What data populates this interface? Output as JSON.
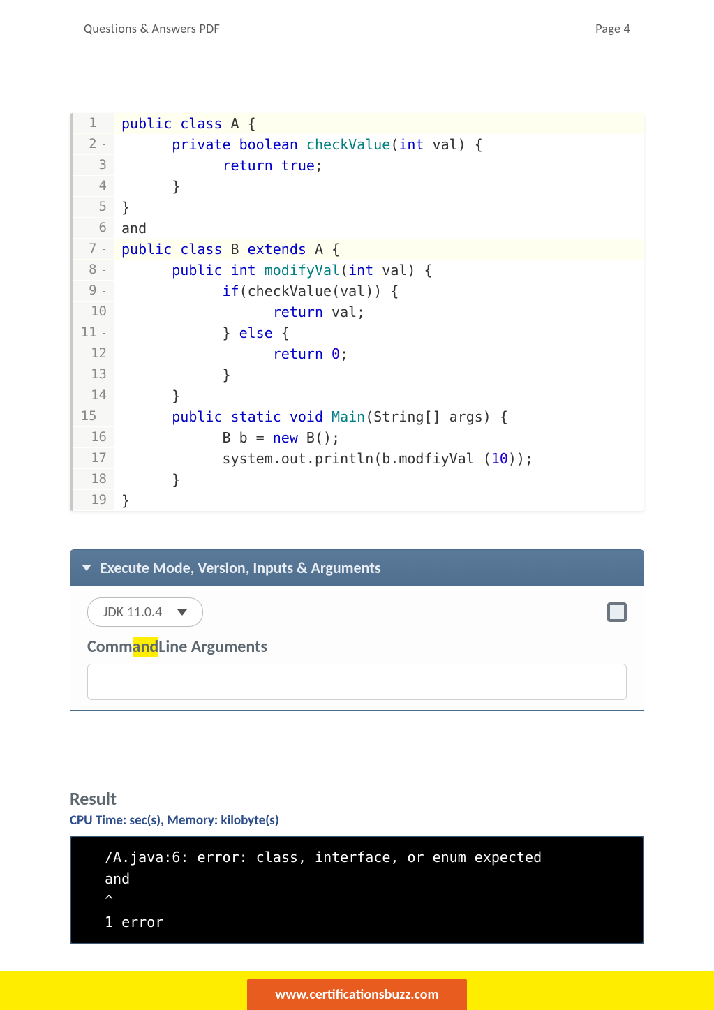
{
  "header": {
    "left": "Questions & Answers PDF",
    "right": "Page 4"
  },
  "code": {
    "lines": [
      {
        "n": "1",
        "fold": true,
        "hl": true,
        "tokens": [
          {
            "t": "public class ",
            "c": "kw"
          },
          {
            "t": "A {",
            "c": "plain"
          }
        ]
      },
      {
        "n": "2",
        "fold": true,
        "hl": false,
        "tokens": [
          {
            "t": "      ",
            "c": "plain"
          },
          {
            "t": "private boolean ",
            "c": "kw"
          },
          {
            "t": "checkValue",
            "c": "fn"
          },
          {
            "t": "(",
            "c": "plain"
          },
          {
            "t": "int ",
            "c": "kw"
          },
          {
            "t": "val) {",
            "c": "plain"
          }
        ]
      },
      {
        "n": "3",
        "fold": false,
        "hl": false,
        "tokens": [
          {
            "t": "            ",
            "c": "plain"
          },
          {
            "t": "return true",
            "c": "kw"
          },
          {
            "t": ";",
            "c": "plain"
          }
        ]
      },
      {
        "n": "4",
        "fold": false,
        "hl": false,
        "tokens": [
          {
            "t": "      }",
            "c": "plain"
          }
        ]
      },
      {
        "n": "5",
        "fold": false,
        "hl": false,
        "tokens": [
          {
            "t": "}",
            "c": "plain"
          }
        ]
      },
      {
        "n": "6",
        "fold": false,
        "hl": false,
        "tokens": [
          {
            "t": "and",
            "c": "plain"
          }
        ]
      },
      {
        "n": "7",
        "fold": true,
        "hl": true,
        "tokens": [
          {
            "t": "public class ",
            "c": "kw"
          },
          {
            "t": "B ",
            "c": "plain"
          },
          {
            "t": "extends ",
            "c": "kw"
          },
          {
            "t": "A {",
            "c": "plain"
          }
        ]
      },
      {
        "n": "8",
        "fold": true,
        "hl": false,
        "tokens": [
          {
            "t": "      ",
            "c": "plain"
          },
          {
            "t": "public int ",
            "c": "kw"
          },
          {
            "t": "modifyVal",
            "c": "fn"
          },
          {
            "t": "(",
            "c": "plain"
          },
          {
            "t": "int ",
            "c": "kw"
          },
          {
            "t": "val) {",
            "c": "plain"
          }
        ]
      },
      {
        "n": "9",
        "fold": true,
        "hl": false,
        "tokens": [
          {
            "t": "            ",
            "c": "plain"
          },
          {
            "t": "if",
            "c": "kw"
          },
          {
            "t": "(checkValue(val)) {",
            "c": "plain"
          }
        ]
      },
      {
        "n": "10",
        "fold": false,
        "hl": false,
        "tokens": [
          {
            "t": "                  ",
            "c": "plain"
          },
          {
            "t": "return ",
            "c": "kw"
          },
          {
            "t": "val;",
            "c": "plain"
          }
        ]
      },
      {
        "n": "11",
        "fold": true,
        "hl": false,
        "tokens": [
          {
            "t": "            } ",
            "c": "plain"
          },
          {
            "t": "else ",
            "c": "kw"
          },
          {
            "t": "{",
            "c": "plain"
          }
        ]
      },
      {
        "n": "12",
        "fold": false,
        "hl": false,
        "tokens": [
          {
            "t": "                  ",
            "c": "plain"
          },
          {
            "t": "return ",
            "c": "kw"
          },
          {
            "t": "0",
            "c": "num"
          },
          {
            "t": ";",
            "c": "plain"
          }
        ]
      },
      {
        "n": "13",
        "fold": false,
        "hl": false,
        "tokens": [
          {
            "t": "            }",
            "c": "plain"
          }
        ]
      },
      {
        "n": "14",
        "fold": false,
        "hl": false,
        "tokens": [
          {
            "t": "      }",
            "c": "plain"
          }
        ]
      },
      {
        "n": "15",
        "fold": true,
        "hl": false,
        "tokens": [
          {
            "t": "      ",
            "c": "plain"
          },
          {
            "t": "public static void ",
            "c": "kw"
          },
          {
            "t": "Main",
            "c": "fn"
          },
          {
            "t": "(String[] args) {",
            "c": "plain"
          }
        ]
      },
      {
        "n": "16",
        "fold": false,
        "hl": false,
        "tokens": [
          {
            "t": "            B b = ",
            "c": "plain"
          },
          {
            "t": "new ",
            "c": "kw"
          },
          {
            "t": "B();",
            "c": "plain"
          }
        ]
      },
      {
        "n": "17",
        "fold": false,
        "hl": false,
        "tokens": [
          {
            "t": "            system.out.println(b.modfiyVal (",
            "c": "plain"
          },
          {
            "t": "10",
            "c": "num"
          },
          {
            "t": "));",
            "c": "plain"
          }
        ]
      },
      {
        "n": "18",
        "fold": false,
        "hl": false,
        "tokens": [
          {
            "t": "      }",
            "c": "plain"
          }
        ]
      },
      {
        "n": "19",
        "fold": false,
        "hl": false,
        "tokens": [
          {
            "t": "}",
            "c": "plain"
          }
        ]
      }
    ]
  },
  "exec": {
    "title": "Execute Mode, Version, Inputs & Arguments",
    "jdk": "JDK 11.0.4",
    "cmd_prefix": "Comm",
    "cmd_highlight": "and",
    "cmd_suffix": "Line Arguments"
  },
  "result": {
    "title": "Result",
    "cpu": "CPU Time: sec(s), Memory: kilobyte(s)",
    "terminal": "/A.java:6: error: class, interface, or enum expected\nand\n^\n1 error"
  },
  "footer": {
    "url": "www.certificationsbuzz.com"
  }
}
